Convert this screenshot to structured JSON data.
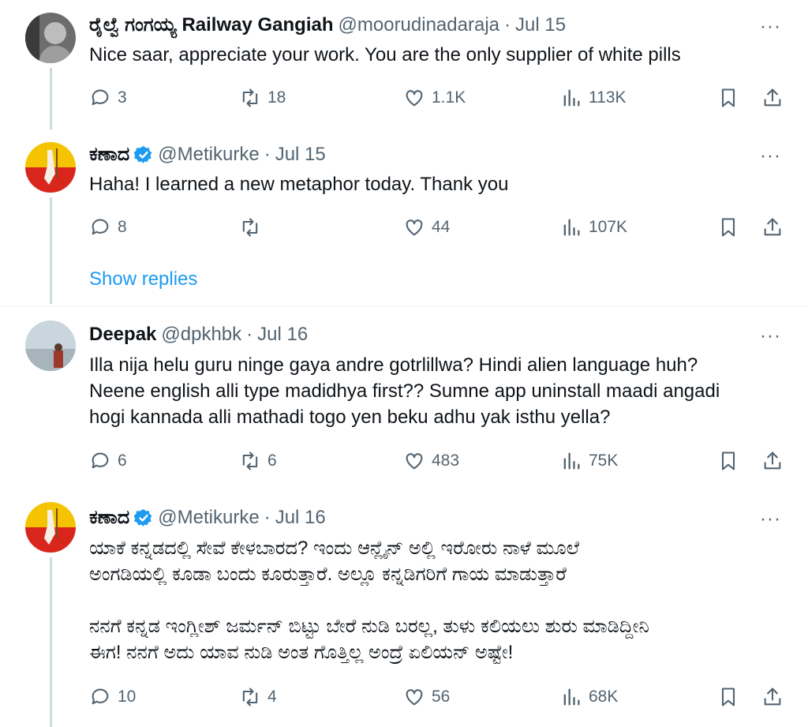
{
  "tweets": [
    {
      "name": "ರೈಲ್ವೆ ಗಂಗಯ್ಯ Railway Gangiah",
      "handle": "@moorudinadaraja",
      "date": "Jul 15",
      "text": "Nice saar, appreciate your work. You are the only supplier of white pills",
      "replies": "3",
      "retweets": "18",
      "likes": "1.1K",
      "views": "113K",
      "verified": false
    },
    {
      "name": "ಕಣಾದ",
      "handle": "@Metikurke",
      "date": "Jul 15",
      "text": "Haha! I learned a new metaphor today. Thank you",
      "replies": "8",
      "retweets": "",
      "likes": "44",
      "views": "107K",
      "verified": true
    },
    {
      "name": "Deepak",
      "handle": "@dpkhbk",
      "date": "Jul 16",
      "text": "Illa nija helu guru ninge gaya andre gotrlillwa? Hindi alien language huh?\nNeene english alli type madidhya first?? Sumne app uninstall maadi angadi\nhogi kannada alli mathadi togo yen beku adhu yak isthu yella?",
      "replies": "6",
      "retweets": "6",
      "likes": "483",
      "views": "75K",
      "verified": false
    },
    {
      "name": "ಕಣಾದ",
      "handle": "@Metikurke",
      "date": "Jul 16",
      "text": "ಯಾಕೆ ಕನ್ನಡದಲ್ಲಿ ಸೇವೆ ಕೇಳಬಾರದ? ಇಂದು ಆನ್ಲೈನ್ ಅಲ್ಲಿ ಇರೋರು ನಾಳೆ ಮೂಲೆ\nಅಂಗಡಿಯಲ್ಲಿ ಕೂಡಾ ಬಂದು ಕೂರುತ್ತಾರೆ. ಅಲ್ಲೂ ಕನ್ನಡಿಗರಿಗೆ ಗಾಯ ಮಾಡುತ್ತಾರೆ\n\nನನಗೆ ಕನ್ನಡ ಇಂಗ್ಲೀಶ್ ಜರ್ಮನ್ ಬಿಟ್ಟು ಬೇರೆ ನುಡಿ ಬರಲ್ಲ, ತುಳು ಕಲಿಯಲು ಶುರು ಮಾಡಿದ್ದೀನಿ\nಈಗ! ನನಗೆ ಅದು ಯಾವ ನುಡಿ ಅಂತ ಗೊತ್ತಿಲ್ಲ ಅಂದ್ರೆ ಏಲಿಯನ್ ಅಷ್ಟೇ!",
      "replies": "10",
      "retweets": "4",
      "likes": "56",
      "views": "68K",
      "verified": true
    }
  ],
  "show_replies_label": "Show replies",
  "more_label": "···",
  "separator": "·",
  "colors": {
    "accent": "#1d9bf0",
    "muted": "#536471",
    "verified": "#1d9bf0"
  },
  "icons": [
    "reply-icon",
    "retweet-icon",
    "like-icon",
    "views-icon",
    "bookmark-icon",
    "share-icon",
    "more-icon",
    "verified-badge-icon"
  ]
}
